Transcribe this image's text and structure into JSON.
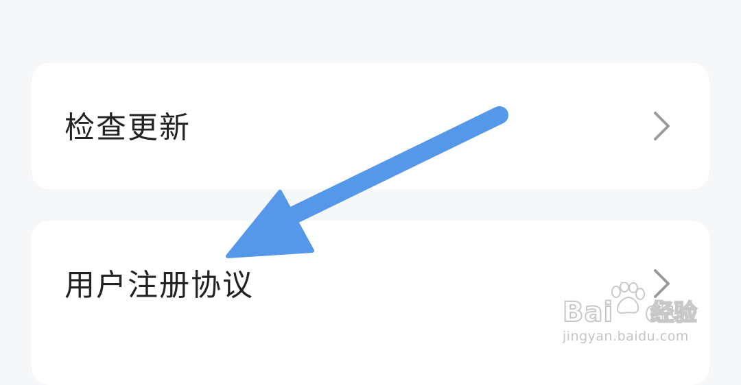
{
  "settings": {
    "items": [
      {
        "label": "检查更新",
        "icon": "chevron-right-icon"
      },
      {
        "label": "用户注册协议",
        "icon": "chevron-right-icon"
      }
    ]
  },
  "annotation": {
    "arrow_color": "#5597e8"
  },
  "watermark": {
    "brand_prefix": "Bai",
    "brand_suffix": "du",
    "brand_cn": "经验",
    "url": "jingyan.baidu.com"
  },
  "colors": {
    "background": "#f6f7f9",
    "card": "#ffffff",
    "text": "#222222",
    "chevron": "#9a9a9a"
  }
}
